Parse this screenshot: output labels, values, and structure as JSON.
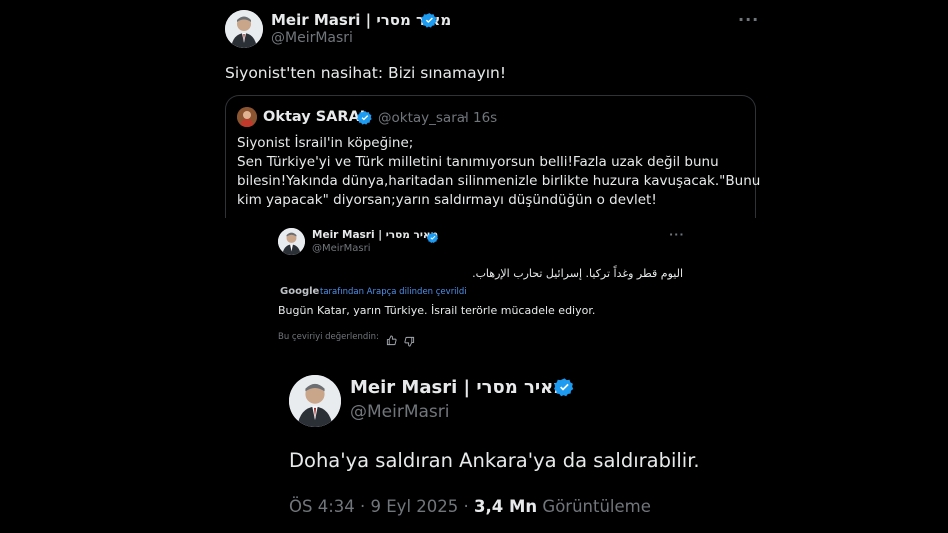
{
  "tweet": {
    "author_name": "Meir Masri | מאיר מסרי",
    "author_handle": "@MeirMasri",
    "more_label": "···",
    "text": "Siyonist'ten nasihat: Bizi sınamayın!"
  },
  "quoted": {
    "author_name": "Oktay SARAL",
    "author_handle": "@oktay_saral",
    "separator": "·",
    "time": "16s",
    "lines": [
      "Siyonist İsrail'in köpeğine;",
      "Sen Türkiye'yi ve Türk milletini tanımıyorsun belli!Fazla uzak değil bunu",
      "bilesin!Yakında dünya,haritadan silinmenizle birlikte huzura kavuşacak.\"Bunu",
      "kim yapacak\" diyorsan;yarın saldırmayı düşündüğün o devlet!"
    ]
  },
  "embedded_small": {
    "author_name": "Meir Masri | מאיר מסרי",
    "author_handle": "@MeirMasri",
    "more_label": "···",
    "arabic_text": "اليوم قطر وغداً تركيا. إسرائيل تحارب الإرهاب.",
    "google_label": "Google",
    "translated_by": "tarafından Arapça dilinden çevrildi",
    "translation": "Bugün Katar, yarın Türkiye. İsrail terörle mücadele ediyor.",
    "rate_label": "Bu çeviriyi değerlendin:"
  },
  "embedded_large": {
    "author_name": "Meir Masri | מאיר מסרי",
    "author_handle": "@MeirMasri",
    "text": "Doha'ya saldıran Ankara'ya da saldırabilir.",
    "time": "ÖS 4:34",
    "dot": "·",
    "date": "9 Eyl 2025",
    "views_count": "3,4 Mn",
    "views_label": "Görüntüleme"
  },
  "colors": {
    "verified": "#1d9bf0",
    "muted": "#71767b",
    "text": "#e7e9ea",
    "background": "#000000",
    "border": "#2f3336",
    "google_blue": "#4285f4"
  },
  "icons": [
    "avatar-portrait",
    "verified-badge-icon",
    "more-options-icon",
    "thumbs-up-icon",
    "thumbs-down-icon"
  ]
}
